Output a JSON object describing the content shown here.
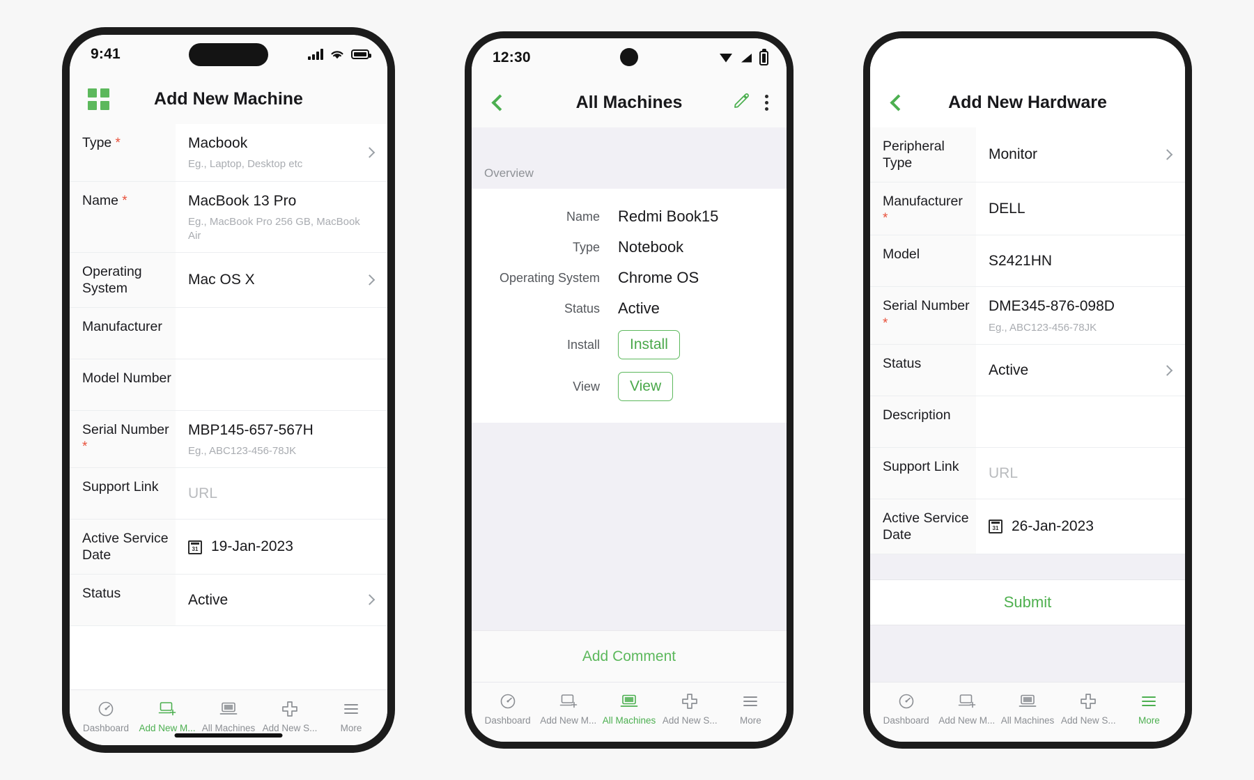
{
  "theme": {
    "accent": "#4caf50",
    "accent_light": "#5cb85c",
    "required_star": "#e8503a",
    "page_bg": "#f7f7f7",
    "panel_bg": "#f1f0f5"
  },
  "phone1": {
    "status": {
      "time": "9:41",
      "signal_icon": "signal-bars-icon",
      "wifi_icon": "wifi-icon",
      "battery_icon": "battery-icon"
    },
    "header": {
      "menu_icon": "grid-menu-icon",
      "title": "Add New Machine"
    },
    "rows": [
      {
        "label": "Type",
        "required": true,
        "required_inline": true,
        "value": "Macbook",
        "hint": "Eg., Laptop, Desktop etc",
        "chevron": true,
        "placeholder": false
      },
      {
        "label": "Name",
        "required": true,
        "required_inline": true,
        "value": "MacBook 13 Pro",
        "hint": "Eg., MacBook Pro 256 GB, MacBook Air",
        "chevron": false,
        "placeholder": false
      },
      {
        "label": "Operating System",
        "required": false,
        "value": "Mac OS X",
        "hint": "",
        "chevron": true,
        "placeholder": false
      },
      {
        "label": "Manufacturer",
        "required": false,
        "value": "",
        "hint": "",
        "chevron": false,
        "placeholder": false
      },
      {
        "label": "Model Number",
        "required": false,
        "value": "",
        "hint": "",
        "chevron": false,
        "placeholder": false
      },
      {
        "label": "Serial Number",
        "required": true,
        "required_inline": false,
        "value": "MBP145-657-567H",
        "hint": "Eg., ABC123-456-78JK",
        "chevron": false,
        "placeholder": false
      },
      {
        "label": "Support Link",
        "required": false,
        "value": "URL",
        "hint": "",
        "chevron": false,
        "placeholder": true
      },
      {
        "label": "Active Service Date",
        "required": false,
        "value": "19-Jan-2023",
        "hint": "",
        "chevron": false,
        "placeholder": false,
        "icon": "calendar-icon"
      },
      {
        "label": "Status",
        "required": false,
        "value": "Active",
        "hint": "",
        "chevron": true,
        "placeholder": false
      }
    ],
    "tabs": [
      {
        "label": "Dashboard",
        "icon": "dashboard-gauge-icon",
        "active": false
      },
      {
        "label": "Add New M...",
        "icon": "add-machine-icon",
        "active": true
      },
      {
        "label": "All Machines",
        "icon": "laptop-icon",
        "active": false
      },
      {
        "label": "Add New S...",
        "icon": "plus-icon",
        "active": false
      },
      {
        "label": "More",
        "icon": "hamburger-icon",
        "active": false
      }
    ]
  },
  "phone2": {
    "status": {
      "time": "12:30",
      "signal_icon": "signal-bars-icon",
      "wifi_icon": "wifi-icon",
      "battery_icon": "battery-icon"
    },
    "header": {
      "back_icon": "chevron-left-icon",
      "title": "All Machines",
      "edit_icon": "pencil-icon",
      "more_icon": "kebab-menu-icon"
    },
    "section_caption": "Overview",
    "details": [
      {
        "key": "Name",
        "value": "Redmi Book15",
        "type": "text"
      },
      {
        "key": "Type",
        "value": "Notebook",
        "type": "text"
      },
      {
        "key": "Operating System",
        "value": "Chrome OS",
        "type": "text"
      },
      {
        "key": "Status",
        "value": "Active",
        "type": "text"
      },
      {
        "key": "Install",
        "value": "Install",
        "type": "button"
      },
      {
        "key": "View",
        "value": "View",
        "type": "button"
      }
    ],
    "add_comment_label": "Add Comment",
    "tabs": [
      {
        "label": "Dashboard",
        "icon": "dashboard-gauge-icon",
        "active": false
      },
      {
        "label": "Add New M...",
        "icon": "add-machine-icon",
        "active": false
      },
      {
        "label": "All Machines",
        "icon": "laptop-icon",
        "active": true
      },
      {
        "label": "Add New S...",
        "icon": "plus-icon",
        "active": false
      },
      {
        "label": "More",
        "icon": "hamburger-icon",
        "active": false
      }
    ]
  },
  "phone3": {
    "header": {
      "back_icon": "chevron-left-icon",
      "title": "Add New Hardware"
    },
    "rows": [
      {
        "label": "Peripheral Type",
        "required": false,
        "value": "Monitor",
        "hint": "",
        "chevron": true,
        "placeholder": false
      },
      {
        "label": "Manufacturer",
        "required": true,
        "required_inline": false,
        "value": "DELL",
        "hint": "",
        "chevron": false,
        "placeholder": false
      },
      {
        "label": "Model",
        "required": false,
        "value": "S2421HN",
        "hint": "",
        "chevron": false,
        "placeholder": false
      },
      {
        "label": "Serial Number",
        "required": true,
        "required_inline": false,
        "value": "DME345-876-098D",
        "hint": "Eg., ABC123-456-78JK",
        "chevron": false,
        "placeholder": false
      },
      {
        "label": "Status",
        "required": false,
        "value": "Active",
        "hint": "",
        "chevron": true,
        "placeholder": false
      },
      {
        "label": "Description",
        "required": false,
        "value": "",
        "hint": "",
        "chevron": false,
        "placeholder": false
      },
      {
        "label": "Support Link",
        "required": false,
        "value": "URL",
        "hint": "",
        "chevron": false,
        "placeholder": true
      },
      {
        "label": "Active Service Date",
        "required": false,
        "value": "26-Jan-2023",
        "hint": "",
        "chevron": false,
        "placeholder": false,
        "icon": "calendar-icon"
      }
    ],
    "submit_label": "Submit",
    "tabs": [
      {
        "label": "Dashboard",
        "icon": "dashboard-gauge-icon",
        "active": false
      },
      {
        "label": "Add New M...",
        "icon": "add-machine-icon",
        "active": false
      },
      {
        "label": "All Machines",
        "icon": "laptop-icon",
        "active": false
      },
      {
        "label": "Add New S...",
        "icon": "plus-icon",
        "active": false
      },
      {
        "label": "More",
        "icon": "hamburger-icon",
        "active": true
      }
    ]
  }
}
